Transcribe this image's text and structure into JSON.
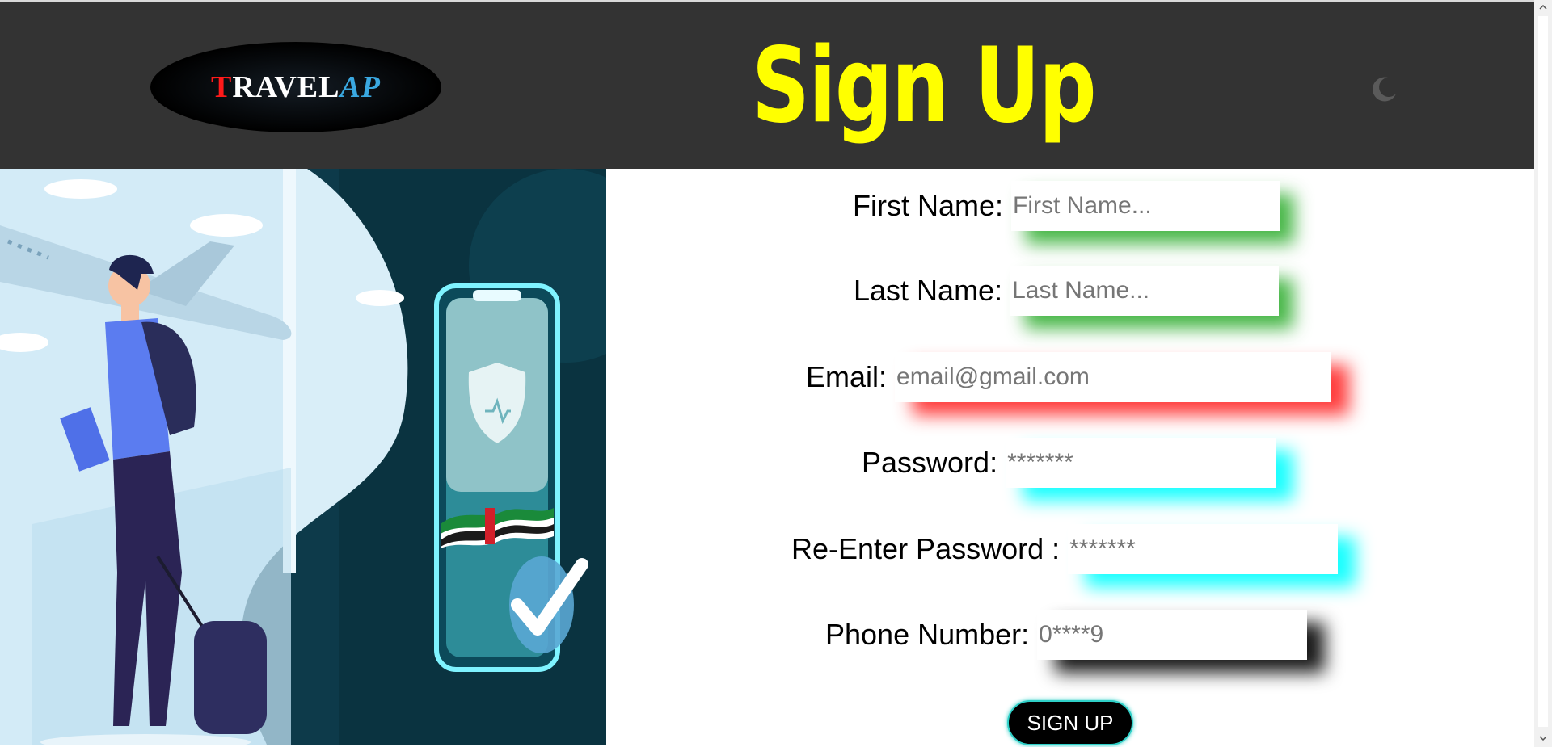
{
  "header": {
    "logo": {
      "t": "T",
      "ravel": "RAVEL",
      "ap": "AP"
    },
    "title": "Sign Up",
    "theme_toggle_icon": "moon-icon"
  },
  "form": {
    "first_name": {
      "label": "First Name:",
      "placeholder": "First Name..."
    },
    "last_name": {
      "label": "Last Name:",
      "placeholder": "Last Name..."
    },
    "email": {
      "label": "Email:",
      "placeholder": "email@gmail.com"
    },
    "password": {
      "label": "Password:",
      "placeholder": "*******"
    },
    "reenter_password": {
      "label": "Re-Enter Password :",
      "placeholder": "*******"
    },
    "phone": {
      "label": "Phone Number:",
      "placeholder": "0****9"
    },
    "submit_label": "SIGN UP"
  },
  "colors": {
    "header_bg": "#333333",
    "title": "#ffff00",
    "glow_green": "#28aa28",
    "glow_red": "#ff2828",
    "glow_cyan": "#00ffff",
    "glow_black": "#000000"
  }
}
